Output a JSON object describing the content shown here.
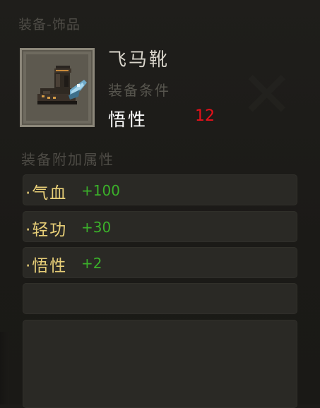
{
  "header": {
    "title": "装备-饰品"
  },
  "item": {
    "name": "飞马靴",
    "icon": "boot-icon",
    "requirement_label": "装备条件",
    "requirement": {
      "stat": "悟性",
      "value": "12"
    }
  },
  "attributes": {
    "title": "装备附加属性",
    "rows": [
      {
        "stat": "·气血",
        "bonus": "+100"
      },
      {
        "stat": "·轻功",
        "bonus": "+30"
      },
      {
        "stat": "·悟性",
        "bonus": "+2"
      },
      {
        "stat": "",
        "bonus": ""
      }
    ]
  },
  "colors": {
    "requirement_value": "#e8101a",
    "bonus": "#3bb02a",
    "stat": "#e8cf78",
    "name": "#d9d5cb"
  }
}
